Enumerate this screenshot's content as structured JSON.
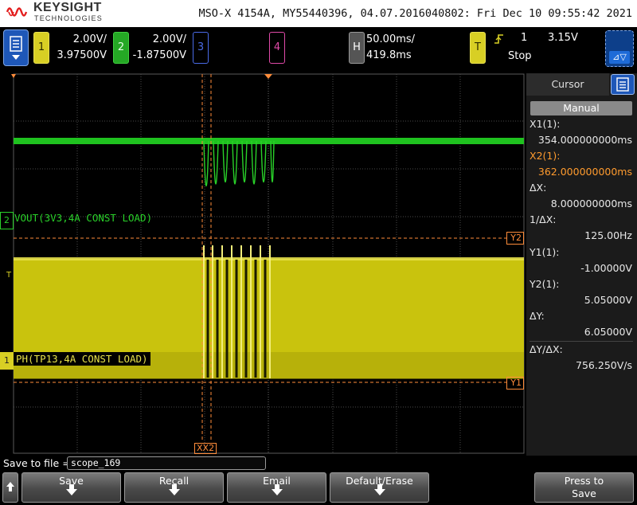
{
  "header": {
    "brand": "KEYSIGHT",
    "brand_sub": "TECHNOLOGIES",
    "instrument_info": "MSO-X 4154A, MY55440396, 04.07.2016040802: Fri Dec 10 09:55:42 2021"
  },
  "channels": {
    "ch1": {
      "number": "1",
      "scale": "2.00V/",
      "offset": "3.97500V",
      "color": "#d8cf24"
    },
    "ch2": {
      "number": "2",
      "scale": "2.00V/",
      "offset": "-1.87500V",
      "color": "#25c425"
    },
    "ch3": {
      "number": "3"
    },
    "ch4": {
      "number": "4"
    }
  },
  "horizontal": {
    "label": "H",
    "timebase": "50.00ms/",
    "position": "419.8ms"
  },
  "trigger": {
    "label": "T",
    "source": "1",
    "level": "3.15V",
    "state": "Stop"
  },
  "plot": {
    "ch2_label": "VOUT(3V3,4A CONST LOAD)",
    "ch1_label": "PH(TP13,4A CONST LOAD)",
    "marker_y1": "Y1",
    "marker_y2": "Y2",
    "marker_x": "XX2",
    "ch1_marker": "1",
    "ch2_marker": "2"
  },
  "cursor_panel": {
    "title": "Cursor",
    "mode_button": "Manual",
    "rows": [
      {
        "label": "X1(1):",
        "value": "354.000000000ms",
        "color": "#e8e8e8"
      },
      {
        "label": "X2(1):",
        "value": "362.000000000ms",
        "color": "#ff9b2e"
      },
      {
        "label": "ΔX:",
        "value": "8.000000000ms",
        "color": "#e8e8e8"
      },
      {
        "label": "1/ΔX:",
        "value": "125.00Hz",
        "color": "#e8e8e8"
      },
      {
        "label": "Y1(1):",
        "value": "-1.00000V",
        "color": "#e8e8e8"
      },
      {
        "label": "Y2(1):",
        "value": "5.05000V",
        "color": "#e8e8e8"
      },
      {
        "label": "ΔY:",
        "value": "6.05000V",
        "color": "#e8e8e8"
      },
      {
        "label": "ΔY/ΔX:",
        "value": "756.250V/s",
        "color": "#e8e8e8"
      }
    ]
  },
  "save": {
    "label": "Save to file =",
    "filename": "scope_169"
  },
  "softkeys": {
    "save": "Save",
    "recall": "Recall",
    "email": "Email",
    "default_erase": "Default/Erase",
    "press_to": "Press to",
    "press_save": "Save"
  },
  "icons": {
    "menu": "menu-icon",
    "measure": "measure-icon",
    "trigger_edge": "rising-edge-icon",
    "up": "up-arrow-icon"
  }
}
